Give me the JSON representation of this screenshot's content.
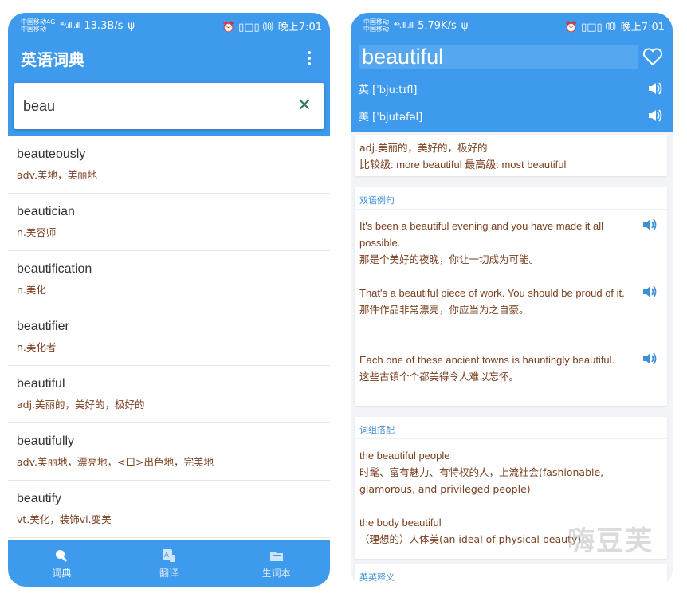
{
  "status_left": {
    "carrier_line1": "中国移动4G",
    "carrier_line2": "中国移动",
    "signal": "⁴ᴳ.ıll .ıll",
    "speed": "13.3B/s",
    "usb": "ψ"
  },
  "status_right": {
    "carrier_line1": "中国移动",
    "carrier_line2": "中国移动",
    "signal": "⁴ᴳ.ıll .ıll",
    "speed": "5.79K/s",
    "usb": "ψ"
  },
  "status_common": {
    "icons": "⏰ ▯□▯ ⑽",
    "battery": "100",
    "time": "晚上7:01"
  },
  "app": {
    "title": "英语词典"
  },
  "search": {
    "value": "beau"
  },
  "word_list": [
    {
      "word": "beauteously",
      "def": "adv.美地，美丽地"
    },
    {
      "word": "beautician",
      "def": "n.美容师"
    },
    {
      "word": "beautification",
      "def": "n.美化"
    },
    {
      "word": "beautifier",
      "def": "n.美化者"
    },
    {
      "word": "beautiful",
      "def": "adj.美丽的，美好的，极好的"
    },
    {
      "word": "beautifully",
      "def": "adv.美丽地，漂亮地，<口>出色地，完美地"
    },
    {
      "word": "beautify",
      "def": "vt.美化，装饰vi.变美"
    }
  ],
  "nav": [
    {
      "label": "词典",
      "icon": "search-icon"
    },
    {
      "label": "翻译",
      "icon": "translate-icon"
    },
    {
      "label": "生词本",
      "icon": "folder-icon"
    }
  ],
  "detail": {
    "word": "beautiful",
    "phon_uk": "英 [ˈbju:tɪfl]",
    "phon_us": "美 [ˈbjutəfəl]",
    "definition": "adj.美丽的，美好的，极好的",
    "compare": "比较级: more beautiful   最高级: most beautiful",
    "examples_head": "双语例句",
    "examples": [
      {
        "en": "It's been a beautiful evening and you have made it all possible.",
        "zh": "那是个美好的夜晚，你让一切成为可能。"
      },
      {
        "en": "That's a beautiful piece of work. You should be proud of it.",
        "zh": "那件作品非常漂亮，你应当为之自豪。"
      },
      {
        "en": "Each one of these ancient towns is hauntingly beautiful.",
        "zh": "这些古镇个个都美得令人难以忘怀。"
      }
    ],
    "phrases_head": "词组搭配",
    "phrases": [
      {
        "en": "the beautiful people",
        "zh": "时髦、富有魅力、有特权的人，上流社会(fashionable, glamorous, and privileged people)"
      },
      {
        "en": "the body beautiful",
        "zh": "（理想的）人体美(an ideal of physical beauty)"
      }
    ],
    "eng_head": "英英释义"
  },
  "watermark": "嗨豆芙",
  "colors": {
    "primary": "#3d9aec",
    "brown": "#7a3f1f",
    "accent_text": "#3d8fd6"
  }
}
